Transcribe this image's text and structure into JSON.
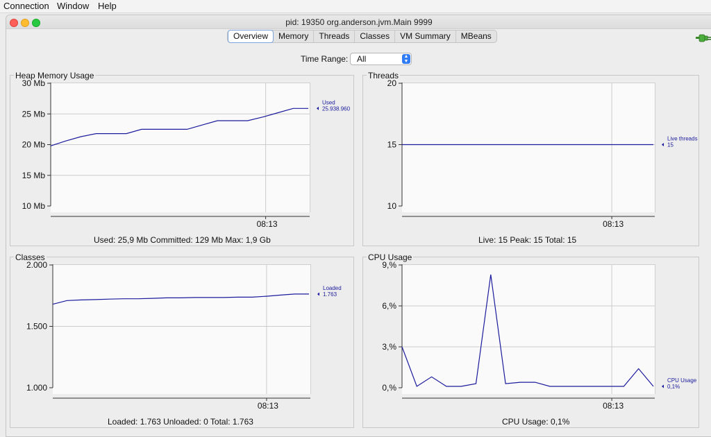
{
  "menubar": {
    "items": [
      "Connection",
      "Window",
      "Help"
    ]
  },
  "window": {
    "title": "pid: 19350 org.anderson.jvm.Main 9999"
  },
  "tabs": [
    "Overview",
    "Memory",
    "Threads",
    "Classes",
    "VM Summary",
    "MBeans"
  ],
  "active_tab": "Overview",
  "time_range": {
    "label": "Time Range:",
    "value": "All"
  },
  "colors": {
    "series": "#1a1a9c",
    "grid": "#cccccc",
    "accent": "#2f7cf6"
  },
  "icons": [
    "plug-icon",
    "dropdown-arrows-icon"
  ],
  "panels": {
    "heap": {
      "title": "Heap Memory Usage",
      "summary": "Used: 25,9 Mb    Committed: 129 Mb    Max: 1,9 Gb"
    },
    "threads": {
      "title": "Threads",
      "summary": "Live: 15    Peak: 15    Total: 15"
    },
    "classes": {
      "title": "Classes",
      "summary": "Loaded: 1.763    Unloaded: 0    Total: 1.763"
    },
    "cpu": {
      "title": "CPU Usage",
      "summary": "CPU Usage: 0,1%"
    }
  },
  "chart_data": [
    {
      "type": "line",
      "title": "Heap Memory Usage",
      "yticks": [
        "30 Mb",
        "25 Mb",
        "20 Mb",
        "15 Mb",
        "10 Mb"
      ],
      "ylim": [
        10,
        30
      ],
      "xtick": "08:13",
      "xtick_frac": 0.83,
      "series": [
        {
          "name": "Used",
          "value_label": "25.938.960",
          "values": [
            19.8,
            20.6,
            21.3,
            21.8,
            21.8,
            21.8,
            22.5,
            22.5,
            22.5,
            22.5,
            23.2,
            23.9,
            23.9,
            23.9,
            24.5,
            25.2,
            25.9,
            25.9
          ]
        }
      ]
    },
    {
      "type": "line",
      "title": "Threads",
      "yticks": [
        "20",
        "15",
        "10"
      ],
      "ylim": [
        10,
        20
      ],
      "xtick": "08:13",
      "xtick_frac": 0.83,
      "series": [
        {
          "name": "Live threads",
          "value_label": "15",
          "values": [
            15,
            15,
            15,
            15,
            15,
            15,
            15,
            15,
            15,
            15,
            15,
            15,
            15,
            15,
            15,
            15,
            15,
            15
          ]
        }
      ]
    },
    {
      "type": "line",
      "title": "Classes",
      "yticks": [
        "2.000",
        "1.500",
        "1.000"
      ],
      "ylim": [
        1000,
        2000
      ],
      "xtick": "08:13",
      "xtick_frac": 0.83,
      "series": [
        {
          "name": "Loaded",
          "value_label": "1.763",
          "values": [
            1680,
            1710,
            1715,
            1718,
            1722,
            1725,
            1725,
            1728,
            1732,
            1732,
            1735,
            1735,
            1735,
            1738,
            1738,
            1745,
            1755,
            1763,
            1763
          ]
        }
      ]
    },
    {
      "type": "line",
      "title": "CPU Usage",
      "yticks": [
        "9,%",
        "6,%",
        "3,%",
        "0,%"
      ],
      "ylim": [
        0,
        9
      ],
      "xtick": "08:13",
      "xtick_frac": 0.83,
      "series": [
        {
          "name": "CPU Usage",
          "value_label": "0,1%",
          "values": [
            3.0,
            0.1,
            0.8,
            0.1,
            0.1,
            0.3,
            8.3,
            0.3,
            0.4,
            0.4,
            0.1,
            0.1,
            0.1,
            0.1,
            0.1,
            0.1,
            1.4,
            0.1
          ]
        }
      ]
    }
  ]
}
